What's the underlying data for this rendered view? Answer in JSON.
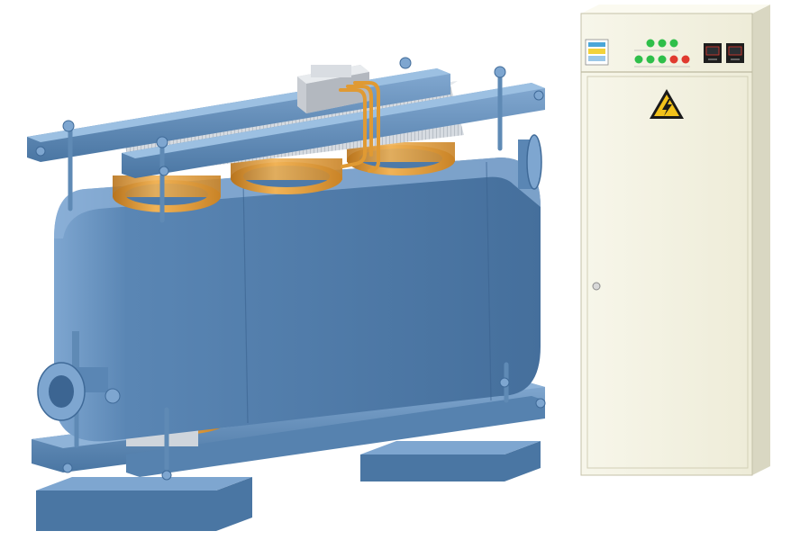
{
  "scene": {
    "subject": "induction-heater-equipment",
    "objects": [
      {
        "name": "transformer-unit",
        "color": "#5a86b4"
      },
      {
        "name": "control-cabinet",
        "color": "#f4f3e3"
      }
    ]
  },
  "transformer": {
    "body_color": "#5a86b4",
    "body_dark": "#3f6a98",
    "body_light": "#7ea6d0",
    "coil_color": "#e8a23c",
    "coil_dark": "#b8741d",
    "core_color": "#c9cfd6"
  },
  "cabinet": {
    "color": "#f4f3e3",
    "side_color": "#d9d7c2",
    "indicator_lights": [
      {
        "color": "#2fbf4a"
      },
      {
        "color": "#2fbf4a"
      },
      {
        "color": "#2fbf4a"
      },
      {
        "color": "#2fbf4a"
      },
      {
        "color": "#2fbf4a"
      },
      {
        "color": "#2fbf4a"
      },
      {
        "color": "#e03a2f"
      },
      {
        "color": "#e03a2f"
      }
    ],
    "meter_icons": [
      "digital-meter-icon",
      "digital-meter-icon"
    ],
    "warning_icon": "high-voltage-warning-icon",
    "warning_color": "#f2c21b"
  }
}
